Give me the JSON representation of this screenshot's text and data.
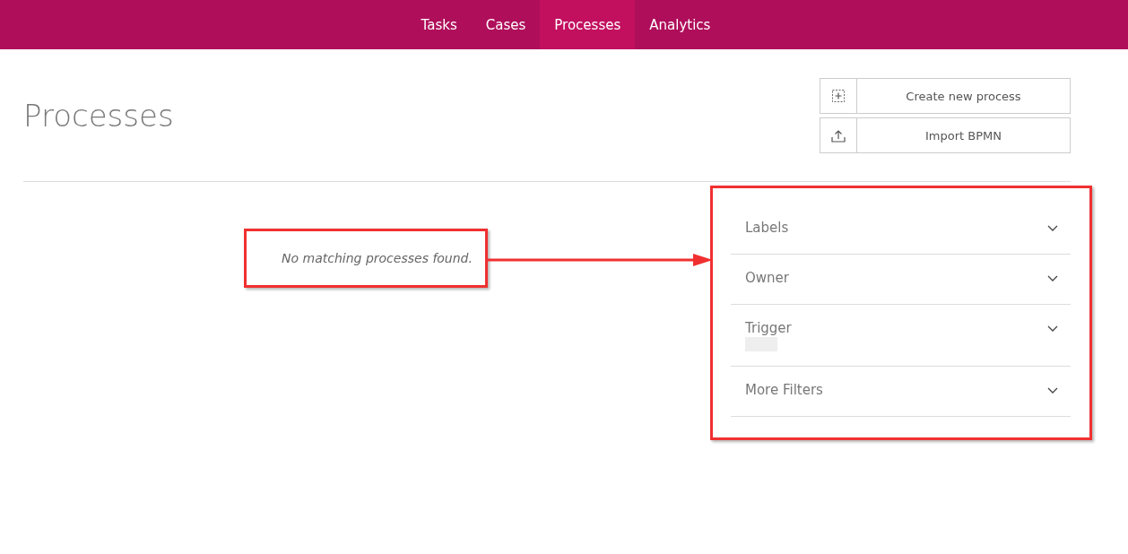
{
  "nav": {
    "tabs": [
      {
        "label": "Tasks",
        "selected": false
      },
      {
        "label": "Cases",
        "selected": false
      },
      {
        "label": "Processes",
        "selected": true
      },
      {
        "label": "Analytics",
        "selected": false
      }
    ]
  },
  "page": {
    "title": "Processes"
  },
  "actions": [
    {
      "label": "Create new process",
      "kind": "create"
    },
    {
      "label": "Import BPMN",
      "kind": "import"
    }
  ],
  "empty_message": "No matching processes found.",
  "filters": [
    {
      "label": "Labels",
      "expanded": false
    },
    {
      "label": "Owner",
      "expanded": false
    },
    {
      "label": "Trigger",
      "expanded": false,
      "redacted": true
    },
    {
      "label": "More Filters",
      "expanded": false
    }
  ]
}
